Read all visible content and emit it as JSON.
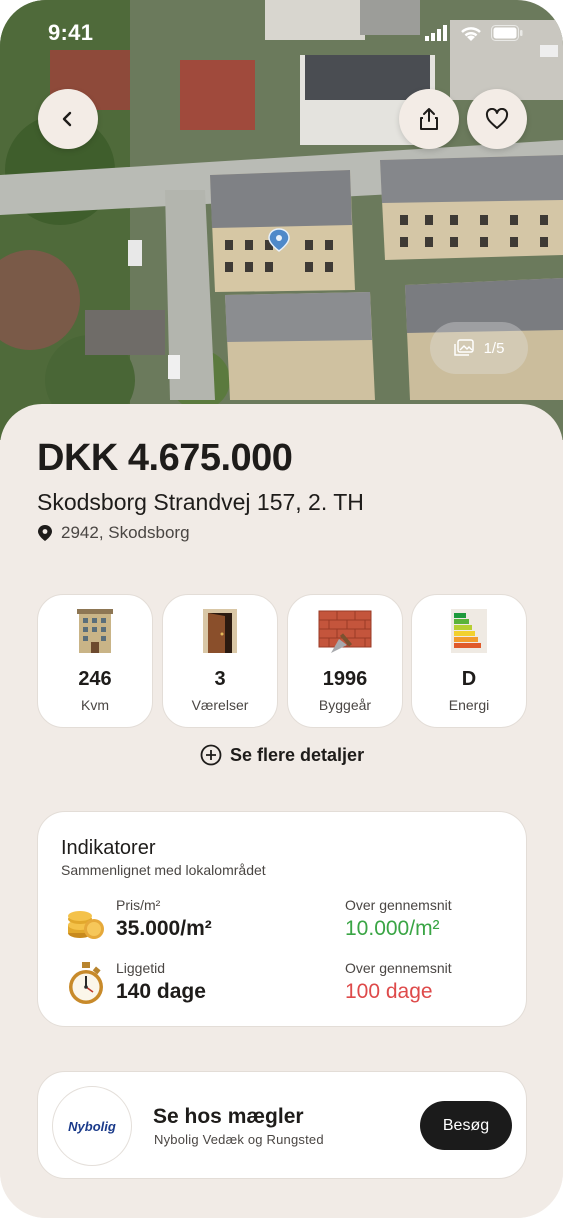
{
  "status_bar": {
    "time": "9:41"
  },
  "photo": {
    "counter": "1/5"
  },
  "listing": {
    "price": "DKK 4.675.000",
    "address": "Skodsborg Strandvej 157, 2. TH",
    "location": "2942, Skodsborg"
  },
  "facts": [
    {
      "value": "246",
      "label": "Kvm",
      "icon": "building-icon"
    },
    {
      "value": "3",
      "label": "Værelser",
      "icon": "door-icon"
    },
    {
      "value": "1996",
      "label": "Byggeår",
      "icon": "bricks-icon"
    },
    {
      "value": "D",
      "label": "Energi",
      "icon": "energy-label-icon"
    }
  ],
  "more_details": "Se flere detaljer",
  "indicators": {
    "title": "Indikatorer",
    "subtitle": "Sammenlignet med lokalområdet",
    "rows": [
      {
        "label": "Pris/m²",
        "value": "35.000/m²",
        "compare_label": "Over gennemsnit",
        "compare_value": "10.000/m²",
        "compare_color": "#3aa545",
        "icon": "coins-icon"
      },
      {
        "label": "Liggetid",
        "value": "140 dage",
        "compare_label": "Over gennemsnit",
        "compare_value": "100 dage",
        "compare_color": "#de4a4a",
        "icon": "stopwatch-icon"
      }
    ]
  },
  "broker": {
    "logo_text": "Nybolig",
    "title": "Se hos mægler",
    "subtitle": "Nybolig Vedæk og Rungsted",
    "button": "Besøg"
  }
}
